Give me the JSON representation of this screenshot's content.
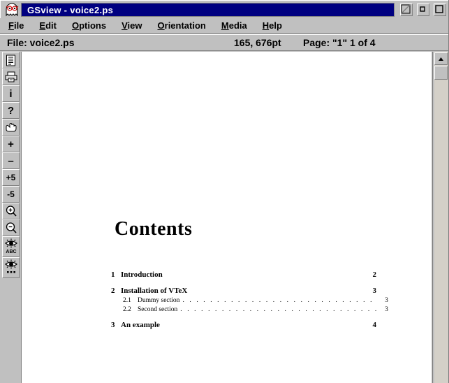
{
  "window": {
    "title": "GSview - voice2.ps",
    "app_icon": "gsview-ghost-icon",
    "controls": [
      {
        "name": "minimize-button",
        "icon": "minimize-icon"
      },
      {
        "name": "restore-button",
        "icon": "restore-icon"
      },
      {
        "name": "maximize-button",
        "icon": "maximize-icon"
      }
    ],
    "colors": {
      "titlebar_active": "#000080",
      "titlebar_text": "#ffffff",
      "face": "#c0c0c0",
      "shadow": "#808080",
      "highlight": "#ffffff",
      "page": "#ffffff"
    }
  },
  "menubar": {
    "items": [
      {
        "label": "File",
        "accel": "F"
      },
      {
        "label": "Edit",
        "accel": "E"
      },
      {
        "label": "Options",
        "accel": "O"
      },
      {
        "label": "View",
        "accel": "V"
      },
      {
        "label": "Orientation",
        "accel": "O"
      },
      {
        "label": "Media",
        "accel": "M"
      },
      {
        "label": "Help",
        "accel": "H"
      }
    ]
  },
  "statusbar": {
    "file_label": "File: voice2.ps",
    "coordinates": "165, 676pt",
    "page_info": "Page: \"1\"  1 of 4"
  },
  "toolbar": {
    "buttons": [
      {
        "name": "document-button",
        "icon": "document-icon",
        "label": ""
      },
      {
        "name": "print-button",
        "icon": "printer-icon",
        "label": ""
      },
      {
        "name": "info-button",
        "icon": "info-icon",
        "label": "i"
      },
      {
        "name": "help-button",
        "icon": "question-mark-icon",
        "label": "?"
      },
      {
        "name": "pointer-button",
        "icon": "pointing-hand-icon",
        "label": ""
      },
      {
        "name": "next-page-button",
        "icon": "plus-icon",
        "label": "+"
      },
      {
        "name": "prev-page-button",
        "icon": "minus-icon",
        "label": "–"
      },
      {
        "name": "forward-five-button",
        "icon": "plus-five-icon",
        "label": "+5"
      },
      {
        "name": "back-five-button",
        "icon": "minus-five-icon",
        "label": "-5"
      },
      {
        "name": "zoom-in-button",
        "icon": "magnifier-plus-icon",
        "label": ""
      },
      {
        "name": "zoom-out-button",
        "icon": "magnifier-minus-icon",
        "label": ""
      },
      {
        "name": "show-text-button",
        "icon": "eye-abc-icon",
        "label": "ABC"
      },
      {
        "name": "show-dots-button",
        "icon": "eye-dots-icon",
        "label": "..."
      }
    ]
  },
  "document": {
    "heading": "Contents",
    "toc": [
      {
        "level": 1,
        "number": "1",
        "label": "Introduction",
        "page": "2",
        "leader": false
      },
      {
        "level": 1,
        "number": "2",
        "label": "Installation of VTeX",
        "page": "3",
        "leader": false
      },
      {
        "level": 2,
        "number": "2.1",
        "label": "Dummy section",
        "page": "3",
        "leader": true
      },
      {
        "level": 2,
        "number": "2.2",
        "label": "Second section",
        "page": "3",
        "leader": true
      },
      {
        "level": 1,
        "number": "3",
        "label": "An example",
        "page": "4",
        "leader": false
      }
    ]
  },
  "scrollbar": {
    "name": "vertical-scrollbar",
    "up_arrow_icon": "triangle-up-icon",
    "thumb_position_percent": 4
  }
}
